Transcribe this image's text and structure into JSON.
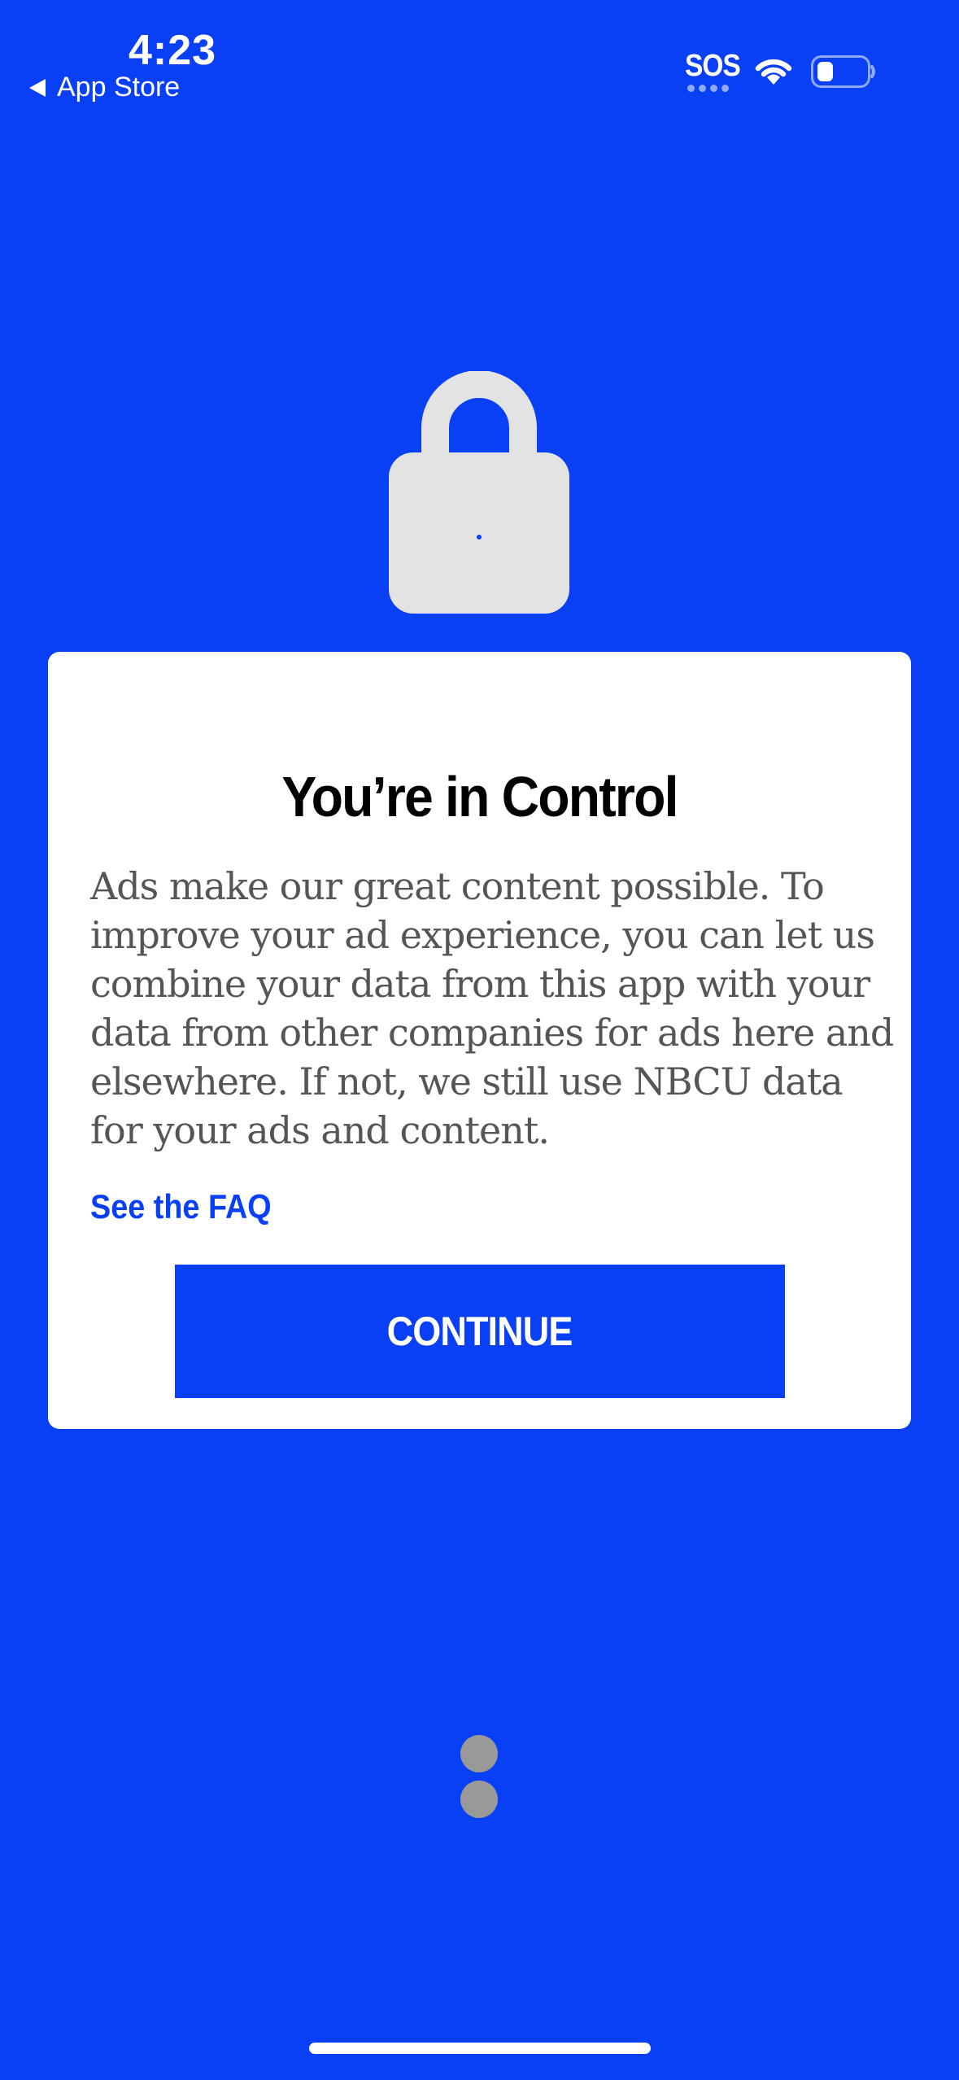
{
  "theme": {
    "background": "#0a40f5",
    "card_background": "#ffffff",
    "accent": "#0a40f5",
    "lock_color": "#e3e3e3",
    "loader_color": "#999999"
  },
  "status_bar": {
    "time": "4:23",
    "back_label": "App Store",
    "sos": "SOS",
    "icons": [
      "back-triangle-icon",
      "wifi-icon",
      "battery-icon"
    ]
  },
  "hero": {
    "icon": "lock-icon"
  },
  "card": {
    "title": "You’re in Control",
    "body": "Ads make our great content possible. To improve your ad experience, you can let us combine your data from this app with your data from other companies for ads here and elsewhere. If not, we still use NBCU data for your ads and content.",
    "faq_link": "See the FAQ",
    "continue_label": "CONTINUE"
  }
}
